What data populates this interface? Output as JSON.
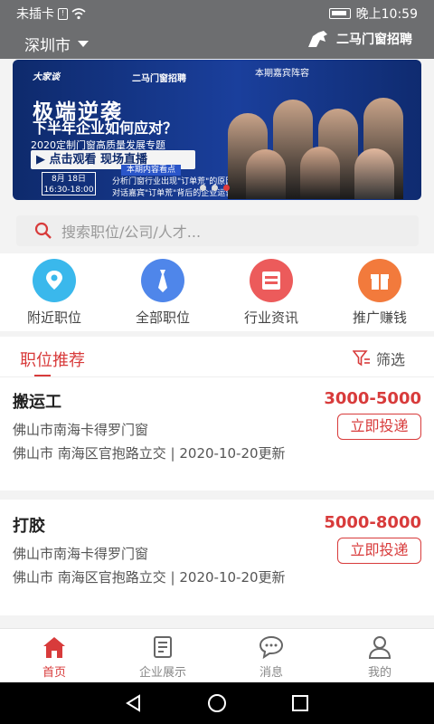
{
  "status_bar": {
    "carrier": "未插卡",
    "time": "晚上10:59"
  },
  "header": {
    "city": "深圳市",
    "brand_name": "二马门窗招聘"
  },
  "banner": {
    "logo_left": "大家谈",
    "logo_right": "二马门窗招聘",
    "headline": "极端逆袭",
    "question": "下半年企业如何应对？",
    "subtitle": "2020定制门窗高质量发展专题",
    "watch_button": "▶ 点击观看  现场直播",
    "date_month": "8月",
    "date_day": "18日",
    "date_time": "16:30-18:00",
    "highlights_tag": "本期内容看点",
    "highlight_1": "分析门窗行业出现\"订单荒\"的原因？",
    "highlight_2": "对话嘉宾\"订单荒\"背后的企业运营方略！",
    "guests_label": "本期嘉宾阵容",
    "slide_count": 3,
    "active_slide": 3
  },
  "search": {
    "placeholder": "搜索职位/公司/人才..."
  },
  "categories": [
    {
      "label": "附近职位",
      "icon": "location-icon",
      "color": "#3ab8ec"
    },
    {
      "label": "全部职位",
      "icon": "tie-icon",
      "color": "#4f86ea"
    },
    {
      "label": "行业资讯",
      "icon": "news-icon",
      "color": "#ec5b5b"
    },
    {
      "label": "推广赚钱",
      "icon": "gift-icon",
      "color": "#f27a3c"
    }
  ],
  "jobs_section": {
    "tab_label": "职位推荐",
    "filter_label": "筛选"
  },
  "jobs": [
    {
      "title": "搬运工",
      "salary": "3000-5000",
      "company": "佛山市南海卡得罗门窗",
      "location": "佛山市  南海区官抱路立交  | 2020-10-20更新",
      "apply_label": "立即投递"
    },
    {
      "title": "打胶",
      "salary": "5000-8000",
      "company": "佛山市南海卡得罗门窗",
      "location": "佛山市  南海区官抱路立交  | 2020-10-20更新",
      "apply_label": "立即投递"
    }
  ],
  "tabbar": [
    {
      "label": "首页",
      "icon": "home-icon",
      "active": true
    },
    {
      "label": "企业展示",
      "icon": "book-icon",
      "active": false
    },
    {
      "label": "消息",
      "icon": "chat-icon",
      "active": false
    },
    {
      "label": "我的",
      "icon": "user-icon",
      "active": false
    }
  ],
  "colors": {
    "accent": "#d83b3b",
    "header_bg": "#6d6e70"
  }
}
